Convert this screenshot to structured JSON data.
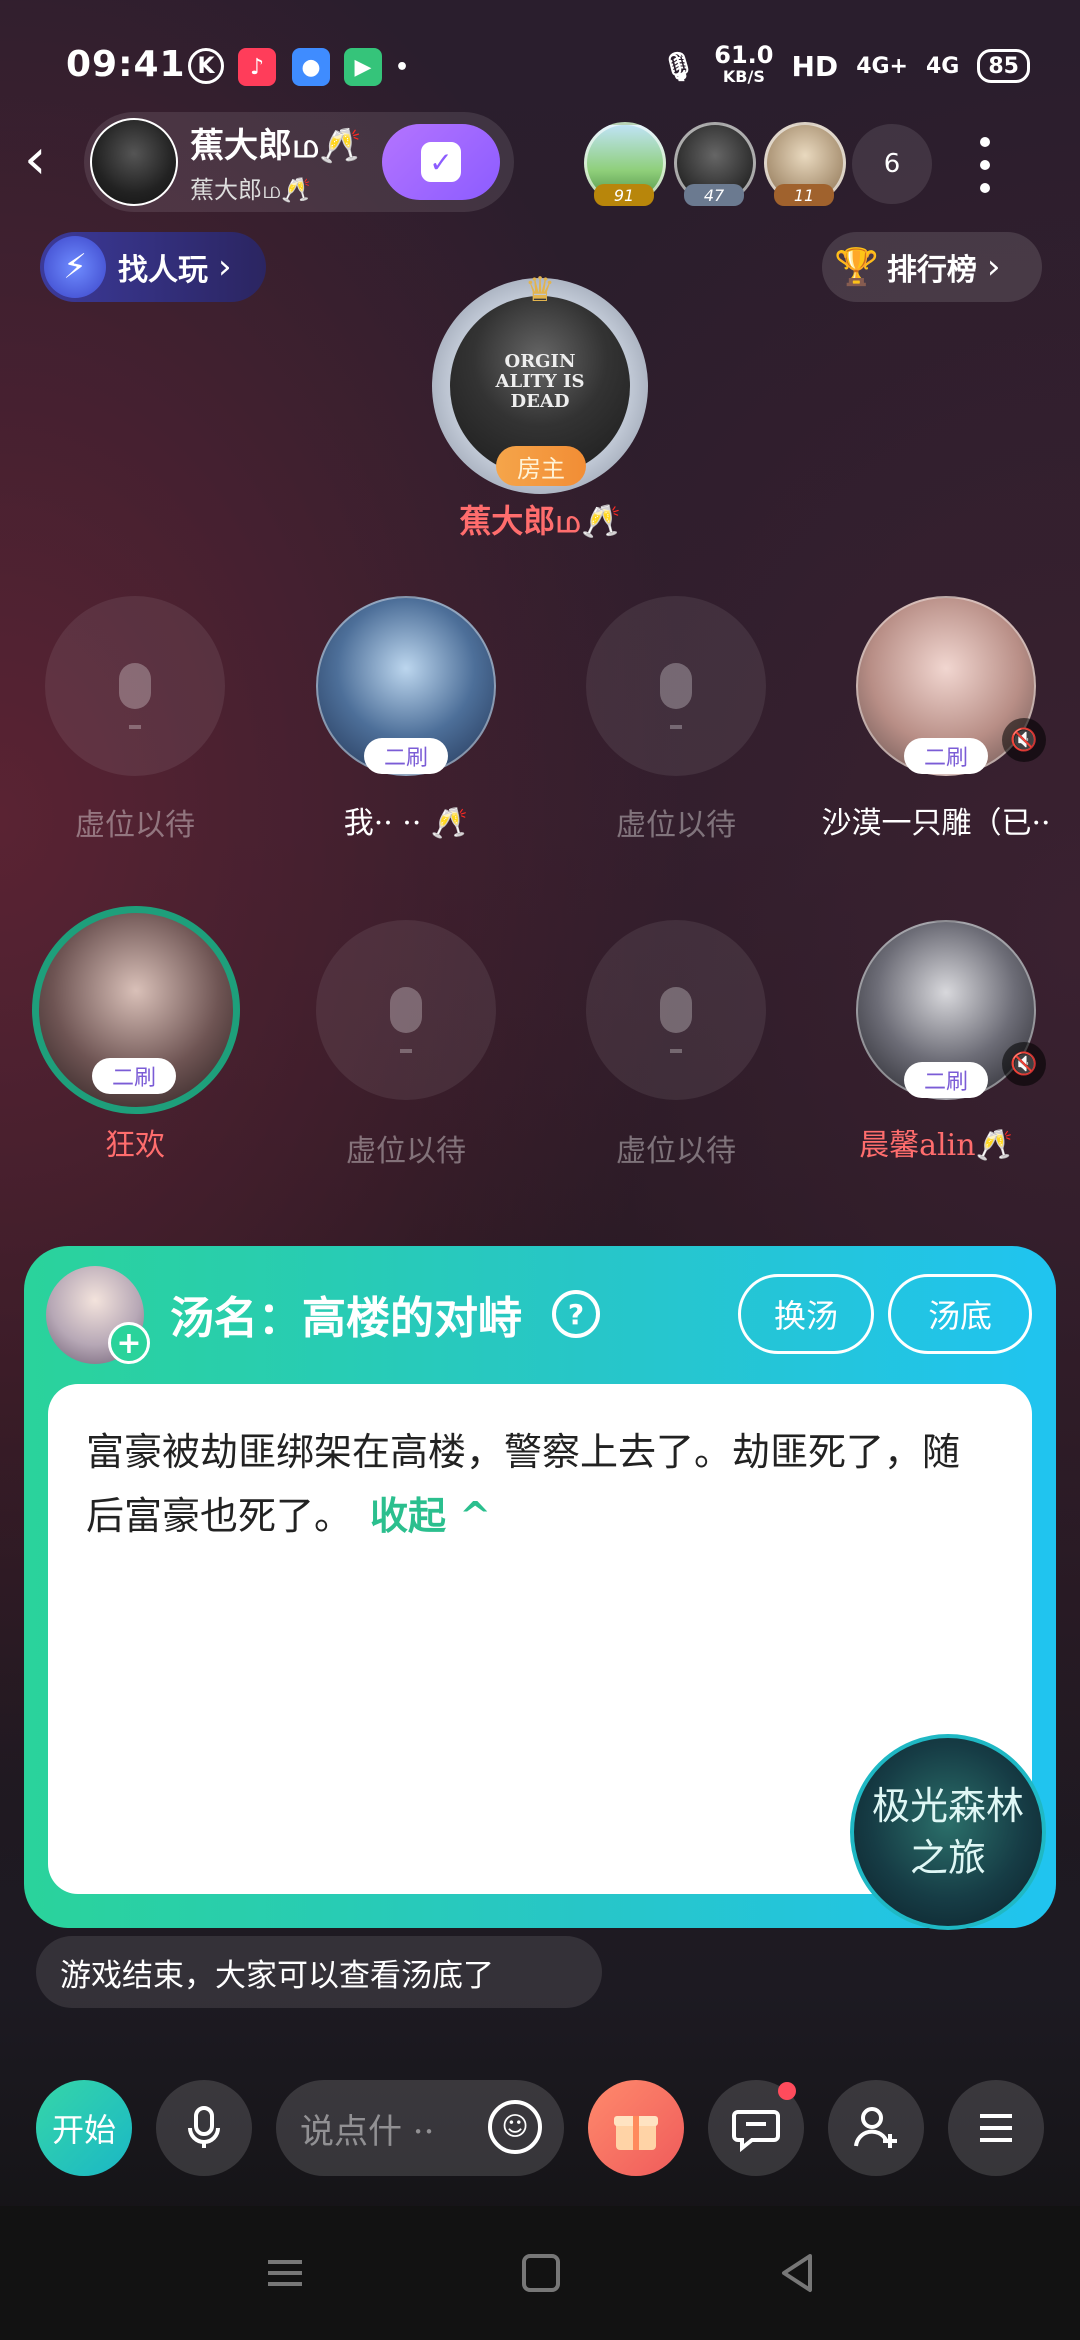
{
  "status_bar": {
    "time": "09:41",
    "net_speed_value": "61.0",
    "net_speed_unit": "KB/S",
    "hd": "HD",
    "sig1": "4G+",
    "sig2": "4G",
    "battery": "85"
  },
  "header": {
    "room_name": "蕉大郎ம🥂",
    "room_sub": "蕉大郎ம🥂",
    "audience_badges": [
      "91",
      "47",
      "11"
    ],
    "online_count": "6"
  },
  "actions": {
    "find_label": "找人玩",
    "rank_label": "排行榜"
  },
  "host": {
    "badge": "房主",
    "name": "蕉大郎ம🥂",
    "hoodie_text": "ORGIN ALITY IS DEAD"
  },
  "seats": [
    {
      "label": "虚位以待",
      "empty": true
    },
    {
      "label": "我·· ·· 🥂",
      "empty": false,
      "tag": "二刷"
    },
    {
      "label": "虚位以待",
      "empty": true
    },
    {
      "label": "沙漠一只雕（已··",
      "empty": false,
      "tag": "二刷",
      "muted": true
    },
    {
      "label": "狂欢",
      "empty": false,
      "tag": "二刷"
    },
    {
      "label": "虚位以待",
      "empty": true
    },
    {
      "label": "虚位以待",
      "empty": true
    },
    {
      "label": "晨馨alin🥂",
      "empty": false,
      "tag": "二刷",
      "muted": true
    }
  ],
  "soup": {
    "title": "汤名：高楼的对峙",
    "change_btn": "换汤",
    "bottom_btn": "汤底",
    "content": "富豪被劫匪绑架在高楼，警察上去了。劫匪死了，随后富豪也死了。",
    "collapse": "收起 ^",
    "badge": "极光森林之旅"
  },
  "system_message": "游戏结束，大家可以查看汤底了",
  "bottom_bar": {
    "start": "开始",
    "input_placeholder": "说点什 ··"
  },
  "colors": {
    "accent_green": "#2ad39b",
    "accent_cyan": "#20c4f0",
    "name_red": "#ff6d6d",
    "tag_purple": "#7b5cd6"
  }
}
